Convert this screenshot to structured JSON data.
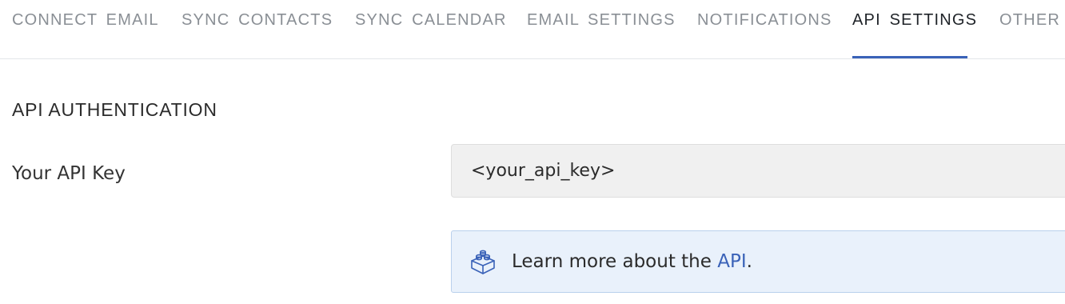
{
  "tabs": [
    {
      "label": "CONNECT EMAIL",
      "active": false
    },
    {
      "label": "SYNC CONTACTS",
      "active": false
    },
    {
      "label": "SYNC CALENDAR",
      "active": false
    },
    {
      "label": "EMAIL SETTINGS",
      "active": false
    },
    {
      "label": "NOTIFICATIONS",
      "active": false
    },
    {
      "label": "API SETTINGS",
      "active": true
    },
    {
      "label": "OTHER",
      "active": false
    }
  ],
  "section": {
    "title": "API AUTHENTICATION"
  },
  "api_key": {
    "label": "Your API Key",
    "value": "<your_api_key>"
  },
  "info": {
    "icon": "lego-block-icon",
    "text_before": "Learn more about the ",
    "link_text": "API",
    "text_after": "."
  },
  "colors": {
    "accent": "#3a62b8",
    "tab_inactive": "#8a8f95",
    "input_bg": "#f0f0f0",
    "info_bg": "#e9f1fb",
    "info_border": "#b9d0ec"
  }
}
